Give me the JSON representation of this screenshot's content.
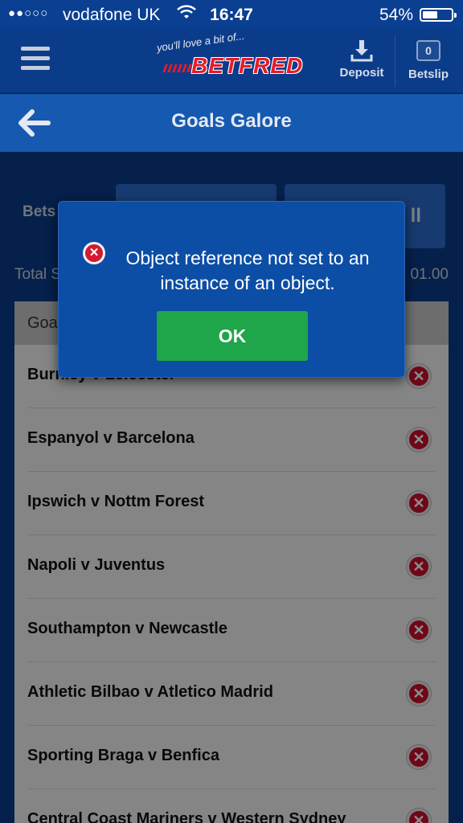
{
  "status_bar": {
    "signal": "●●○○○",
    "carrier": "vodafone UK",
    "time": "16:47",
    "battery_percent": "54%",
    "battery_level": 0.54
  },
  "header": {
    "menu_icon": "hamburger-menu-icon",
    "logo_tagline": "you'll love a bit of...",
    "logo_brand": "BETFRED",
    "deposit_label": "Deposit",
    "betslip_count": "0",
    "betslip_label": "Betslip"
  },
  "subheader": {
    "back_icon": "back-arrow-icon",
    "title": "Goals Galore"
  },
  "background": {
    "bets_label": "Bets",
    "button_2_fragment": "ll",
    "total_label": "Total S",
    "total_value": "01.00",
    "list_header": "Goa",
    "matches": [
      "Burnley v Leicester",
      "Espanyol v Barcelona",
      "Ipswich v Nottm Forest",
      "Napoli v Juventus",
      "Southampton v Newcastle",
      "Athletic Bilbao v Atletico Madrid",
      "Sporting Braga v Benfica",
      "Central Coast Mariners v Western Sydney"
    ],
    "remove_icon": "remove-x-icon"
  },
  "dialog": {
    "icon": "error-icon",
    "message": "Object reference not set to an instance of an object.",
    "ok_label": "OK"
  },
  "colors": {
    "header_blue": "#0b3c8a",
    "subheader_blue": "#1659b0",
    "ok_green": "#1fa54a",
    "error_red": "#d21a32"
  }
}
